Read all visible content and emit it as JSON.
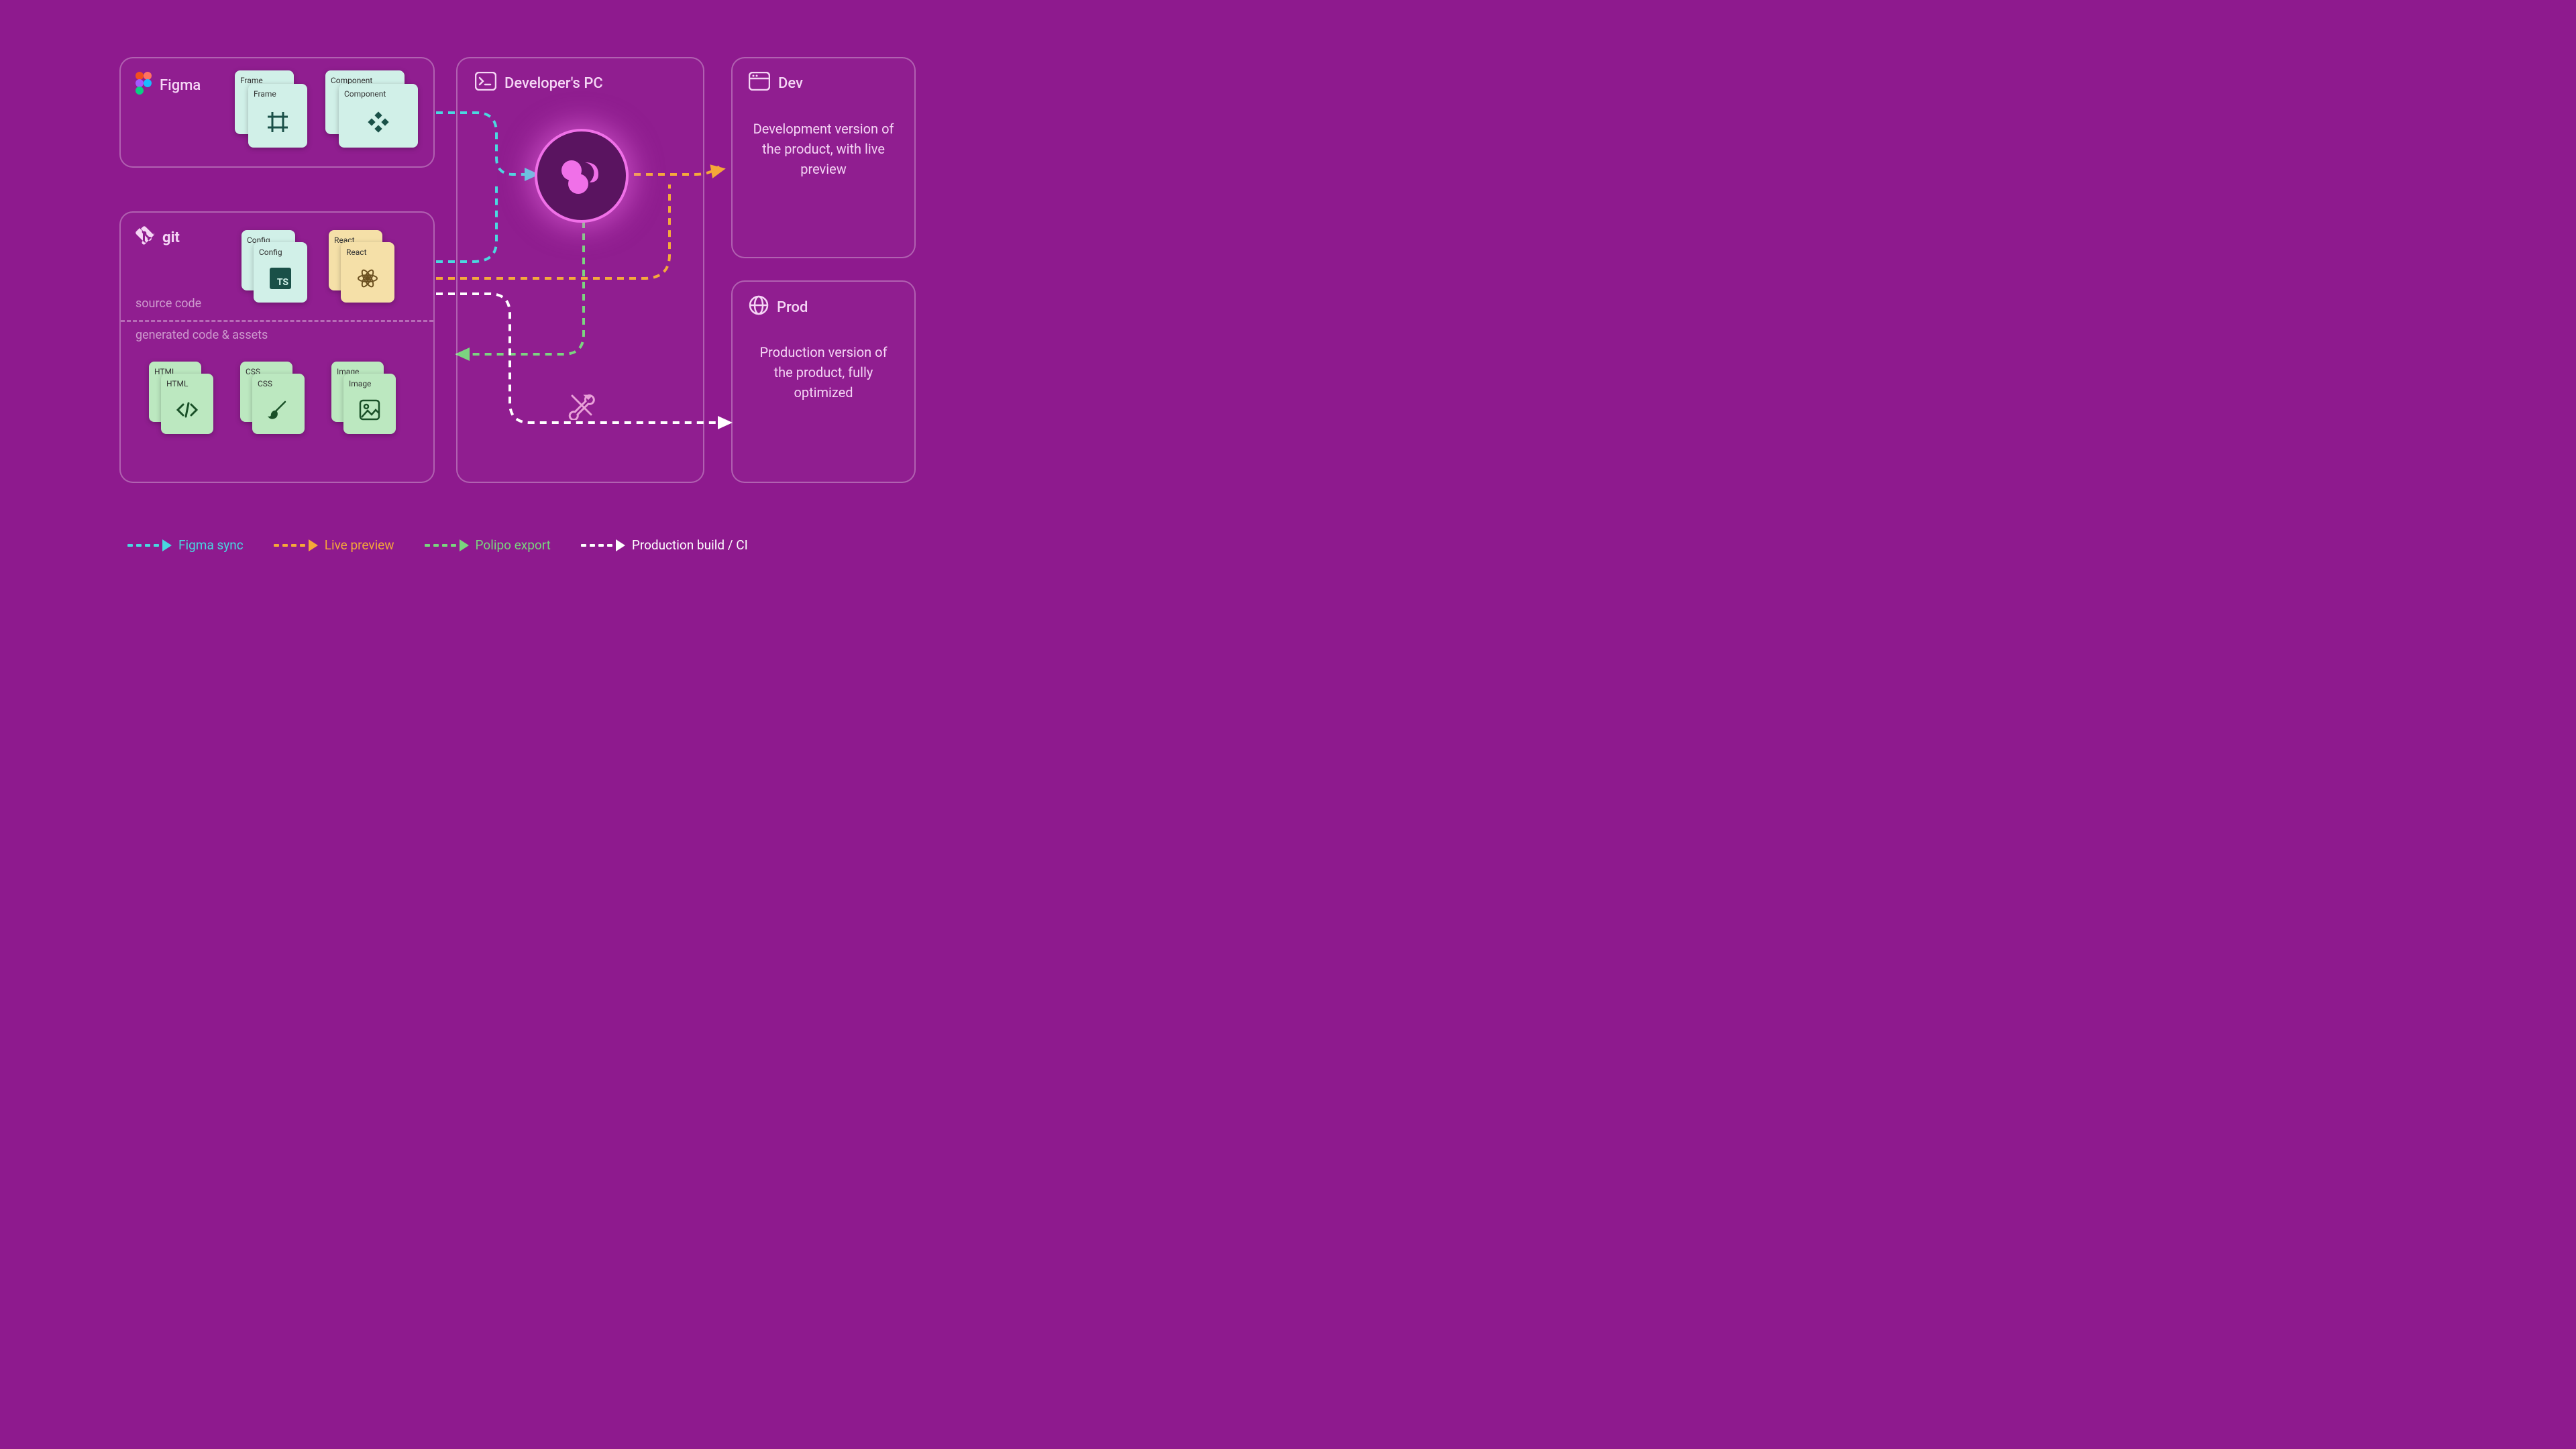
{
  "panels": {
    "figma": {
      "title": "Figma",
      "items": {
        "frame": "Frame",
        "component": "Component"
      }
    },
    "git": {
      "title": "git",
      "source_label": "source code",
      "generated_label": "generated code & assets",
      "items": {
        "config": "Config",
        "react": "React",
        "html": "HTML",
        "css": "CSS",
        "image": "Image"
      }
    },
    "devpc": {
      "title": "Developer's PC"
    },
    "dev": {
      "title": "Dev",
      "desc": "Development version of the product, with live preview"
    },
    "prod": {
      "title": "Prod",
      "desc": "Production version of the product, fully optimized"
    }
  },
  "legend": {
    "figma_sync": "Figma sync",
    "live_preview": "Live preview",
    "polipo_export": "Polipo export",
    "prod_build": "Production build / CI"
  },
  "colors": {
    "cyan": "#48d8e0",
    "orange": "#f5a838",
    "green": "#7ad47e",
    "white": "#ffffff",
    "pink": "#e890d8"
  }
}
